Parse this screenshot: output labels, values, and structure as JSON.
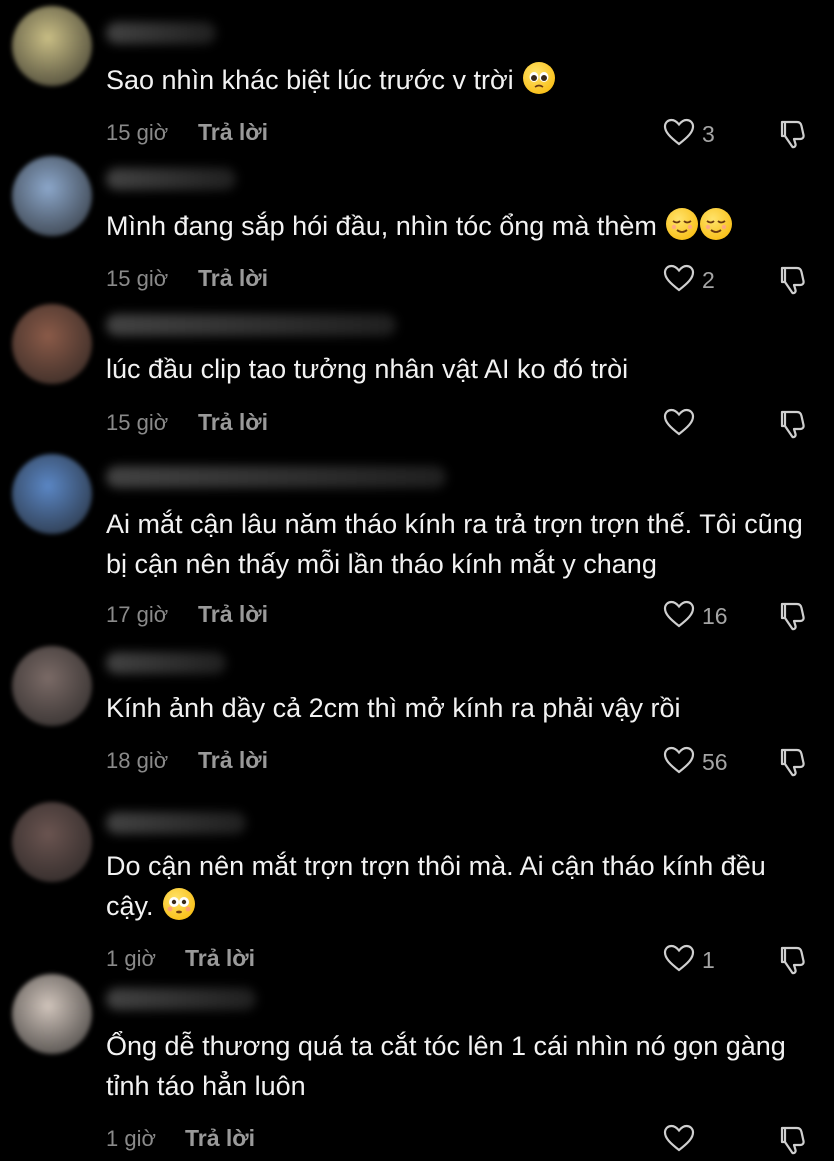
{
  "reply_label": "Trả lời",
  "comments": [
    {
      "text": "Sao nhìn khác biệt lúc trước v trời ",
      "emojis": [
        "pleading-face"
      ],
      "time": "15 giờ",
      "likes": "3",
      "avatar_color": "#c8bd84"
    },
    {
      "text": "Mình đang sắp hói đầu, nhìn tóc ổng mà thèm ",
      "emojis": [
        "relieved-face",
        "relieved-face"
      ],
      "time": "15 giờ",
      "likes": "2",
      "avatar_color": "#8ba6c9"
    },
    {
      "text": "lúc đầu clip tao tưởng nhân vật AI ko đó tròi",
      "emojis": [],
      "time": "15 giờ",
      "likes": "",
      "avatar_color": "#8a5a48"
    },
    {
      "text": "Ai mắt cận lâu năm tháo kính ra trả trợn trợn thế. Tôi cũng bị cận nên thấy mỗi lần tháo kính mắt y chang",
      "emojis": [],
      "time": "17 giờ",
      "likes": "16",
      "avatar_color": "#5a86c4"
    },
    {
      "text": "Kính ảnh dầy cả 2cm thì mở kính ra phải vậy rồi",
      "emojis": [],
      "time": "18 giờ",
      "likes": "56",
      "avatar_color": "#7a6a66"
    },
    {
      "text": "Do cận nên mắt trợn trợn thôi mà. Ai cận tháo kính đều cậy. ",
      "emojis": [
        "flushed-face"
      ],
      "time": "1 giờ",
      "likes": "1",
      "avatar_color": "#6a5450"
    },
    {
      "text": "Ổng dễ thương quá ta cắt tóc lên 1 cái nhìn nó gọn gàng tỉnh táo hẳn luôn",
      "emojis": [],
      "time": "1 giờ",
      "likes": "",
      "avatar_color": "#cfc3ba"
    }
  ]
}
